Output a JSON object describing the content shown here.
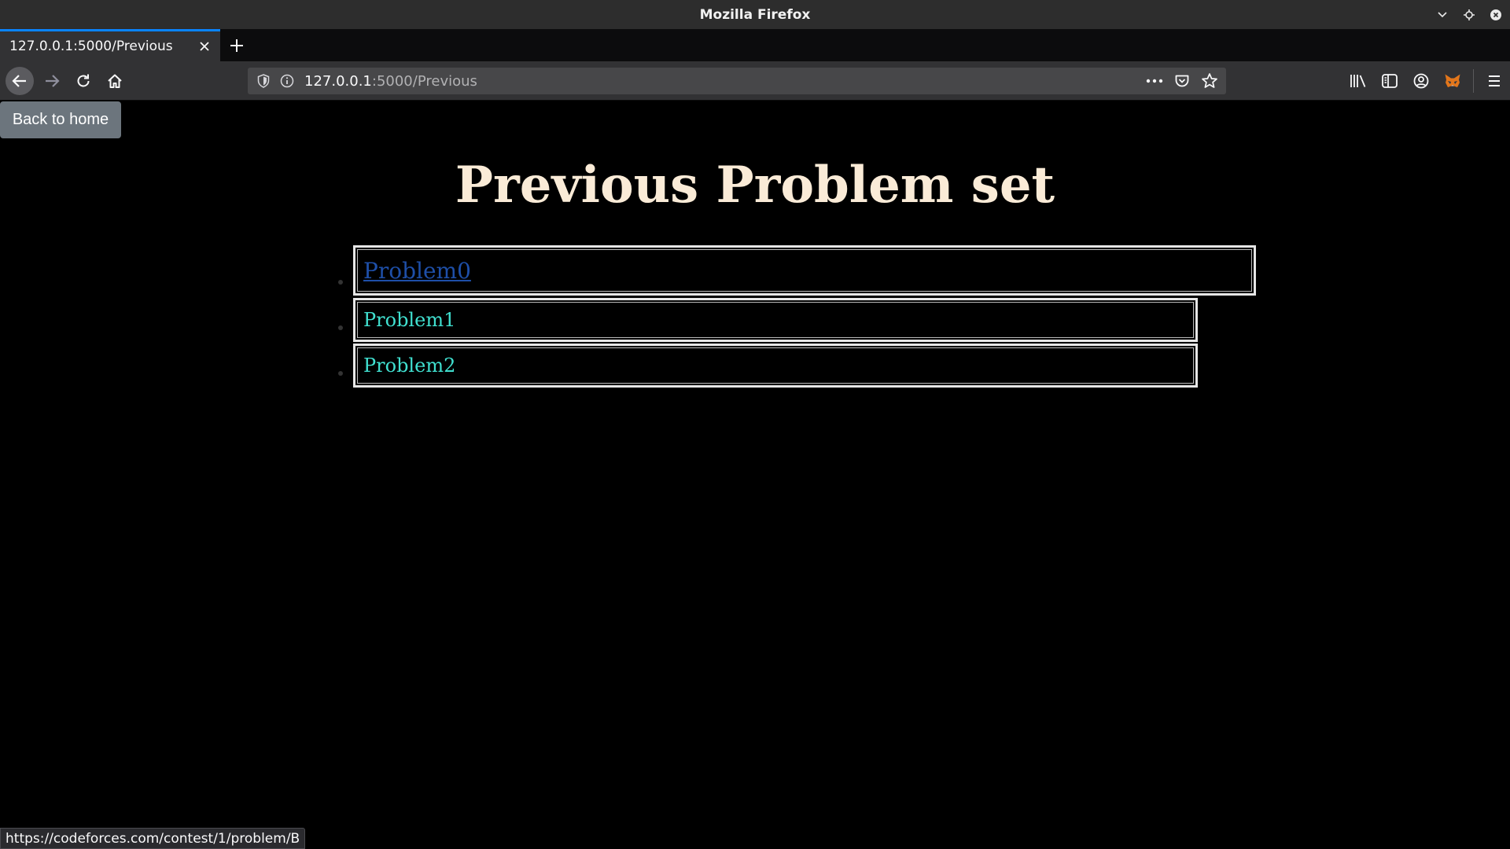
{
  "window": {
    "title": "Mozilla Firefox"
  },
  "tabs": [
    {
      "label": "127.0.0.1:5000/Previous",
      "active": true
    }
  ],
  "navbar": {
    "url_host": "127.0.0.1",
    "url_path": ":5000/Previous",
    "icons": [
      "back-arrow-icon",
      "forward-arrow-icon",
      "reload-icon",
      "home-icon",
      "shield-icon",
      "info-icon",
      "more-dots-icon",
      "pocket-icon",
      "bookmark-star-icon",
      "library-icon",
      "sidebar-icon",
      "account-icon",
      "metamask-fox-icon",
      "hamburger-menu-icon"
    ]
  },
  "page": {
    "home_button": "Back to home",
    "title": "Previous Problem set",
    "problems": [
      {
        "label": "Problem0",
        "hovered": true
      },
      {
        "label": "Problem1",
        "hovered": false
      },
      {
        "label": "Problem2",
        "hovered": false
      }
    ]
  },
  "statusbar": {
    "link_url": "https://codeforces.com/contest/1/problem/B"
  },
  "colors": {
    "page_background": "#000000",
    "title": "#faebd7",
    "link": "#40e0d0",
    "link_hover": "#1e4fa8",
    "home_button": "#6c757d",
    "tab_accent": "#0a84ff"
  }
}
